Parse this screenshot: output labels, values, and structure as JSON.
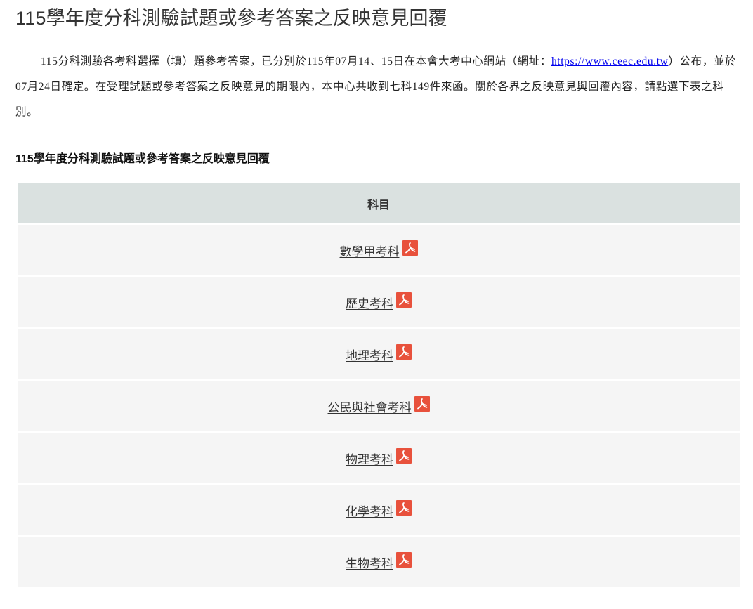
{
  "page": {
    "title": "115學年度分科測驗試題或參考答案之反映意見回覆"
  },
  "intro": {
    "text_before_link": "115分科測驗各考科選擇（填）題參考答案，已分別於115年07月14、15日在本會大考中心網站（網址：",
    "link_text": "https://www.ceec.edu.tw",
    "text_after_link": "）公布，並於07月24日確定。在受理試題或參考答案之反映意見的期限內，本中心共收到七科149件來函。關於各界之反映意見與回覆內容，請點選下表之科別。"
  },
  "table": {
    "title": "115學年度分科測驗試題或參考答案之反映意見回覆",
    "header": "科目",
    "rows": [
      {
        "label": "數學甲考科",
        "icon": "pdf-icon"
      },
      {
        "label": "歷史考科",
        "icon": "pdf-icon"
      },
      {
        "label": "地理考科",
        "icon": "pdf-icon"
      },
      {
        "label": "公民與社會考科",
        "icon": "pdf-icon"
      },
      {
        "label": "物理考科",
        "icon": "pdf-icon"
      },
      {
        "label": "化學考科",
        "icon": "pdf-icon"
      },
      {
        "label": "生物考科",
        "icon": "pdf-icon"
      }
    ]
  },
  "colors": {
    "header_bg": "#dae1e0",
    "row_bg": "#f5f5f5",
    "pdf_icon": "#e8513c",
    "link": "#0000ee"
  }
}
